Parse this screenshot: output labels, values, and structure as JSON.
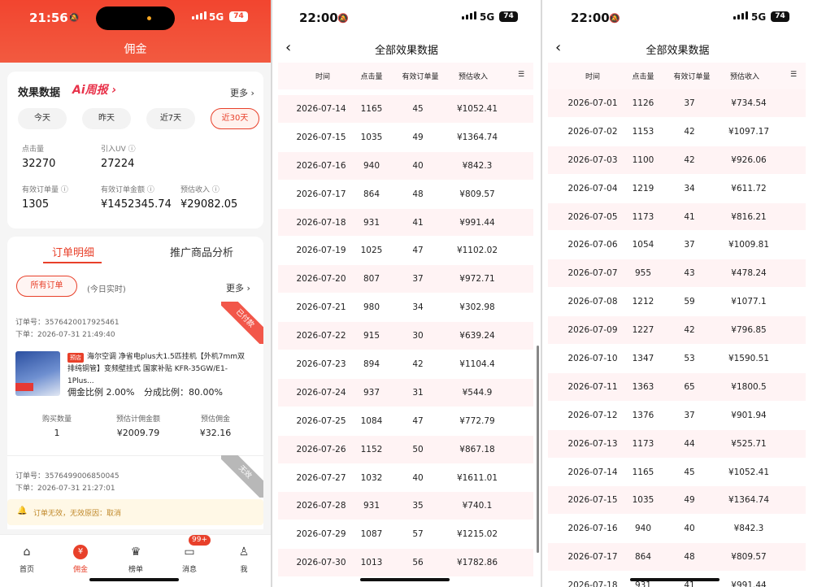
{
  "phone1": {
    "status": {
      "time": "21:56",
      "network": "5G",
      "battery": "74"
    },
    "title": "佣金",
    "effect": {
      "heading": "效果数据",
      "ai_badge": "Ai周报 ›",
      "more": "更多 ›",
      "tabs": [
        "今天",
        "昨天",
        "近7天",
        "近30天"
      ],
      "active_tab": "近30天",
      "stats": [
        {
          "label": "点击量",
          "value": "32270"
        },
        {
          "label": "引入UV ⓘ",
          "value": "27224"
        },
        {
          "label": "有效订单量 ⓘ",
          "value": "1305"
        },
        {
          "label": "有效订单金额 ⓘ",
          "value": "¥1452345.74"
        },
        {
          "label": "预估收入 ⓘ",
          "value": "¥29082.05"
        }
      ]
    },
    "segments": [
      "订单明细",
      "推广商品分析"
    ],
    "filter": {
      "pill": "所有订单",
      "realtime": "(今日实时)",
      "more": "更多 ›"
    },
    "order1": {
      "id": "订单号：3576420017925461",
      "time": "下单：2026-07-31 21:49:40",
      "ribbon": "已付款",
      "tag": "预店",
      "desc": "海尔空调 净省电plus大1.5匹挂机【外机7mm双排纯铜管】变频壁挂式 国家补贴 KFR-35GW/E1-1Plus...",
      "commission_rate": "佣金比例 2.00%",
      "share_rate": "分成比例：80.00%",
      "cols": [
        "购买数量",
        "预估计佣金额",
        "预估佣金"
      ],
      "vals": [
        "1",
        "¥2009.79",
        "¥32.16"
      ]
    },
    "order2": {
      "id": "订单号：3576499006850045",
      "time": "下单：2026-07-31 21:27:01",
      "ribbon": "无效"
    },
    "warning": "订单无效，无效原因：取消",
    "nav": [
      {
        "label": "首页",
        "icon": "home-icon"
      },
      {
        "label": "佣金",
        "icon": "yen-icon"
      },
      {
        "label": "榜单",
        "icon": "trophy-icon"
      },
      {
        "label": "消息",
        "icon": "message-icon"
      },
      {
        "label": "我",
        "icon": "user-icon"
      }
    ],
    "badge": "99+",
    "accent": "#e8402a"
  },
  "phone2": {
    "status": {
      "time": "22:00",
      "network": "5G",
      "battery": "74"
    },
    "title": "全部效果数据",
    "columns": [
      "时间",
      "点击量",
      "有效订单量",
      "预估收入"
    ],
    "rows": [
      [
        "2026-07-14",
        "1165",
        "45",
        "¥1052.41"
      ],
      [
        "2026-07-15",
        "1035",
        "49",
        "¥1364.74"
      ],
      [
        "2026-07-16",
        "940",
        "40",
        "¥842.3"
      ],
      [
        "2026-07-17",
        "864",
        "48",
        "¥809.57"
      ],
      [
        "2026-07-18",
        "931",
        "41",
        "¥991.44"
      ],
      [
        "2026-07-19",
        "1025",
        "47",
        "¥1102.02"
      ],
      [
        "2026-07-20",
        "807",
        "37",
        "¥972.71"
      ],
      [
        "2026-07-21",
        "980",
        "34",
        "¥302.98"
      ],
      [
        "2026-07-22",
        "915",
        "30",
        "¥639.24"
      ],
      [
        "2026-07-23",
        "894",
        "42",
        "¥1104.4"
      ],
      [
        "2026-07-24",
        "937",
        "31",
        "¥544.9"
      ],
      [
        "2026-07-25",
        "1084",
        "47",
        "¥772.79"
      ],
      [
        "2026-07-26",
        "1152",
        "50",
        "¥867.18"
      ],
      [
        "2026-07-27",
        "1032",
        "40",
        "¥1611.01"
      ],
      [
        "2026-07-28",
        "931",
        "35",
        "¥740.1"
      ],
      [
        "2026-07-29",
        "1087",
        "57",
        "¥1215.02"
      ],
      [
        "2026-07-30",
        "1013",
        "56",
        "¥1782.86"
      ]
    ]
  },
  "phone3": {
    "status": {
      "time": "22:00",
      "network": "5G",
      "battery": "74"
    },
    "title": "全部效果数据",
    "columns": [
      "时间",
      "点击量",
      "有效订单量",
      "预估收入"
    ],
    "rows": [
      [
        "2026-07-01",
        "1126",
        "37",
        "¥734.54"
      ],
      [
        "2026-07-02",
        "1153",
        "42",
        "¥1097.17"
      ],
      [
        "2026-07-03",
        "1100",
        "42",
        "¥926.06"
      ],
      [
        "2026-07-04",
        "1219",
        "34",
        "¥611.72"
      ],
      [
        "2026-07-05",
        "1173",
        "41",
        "¥816.21"
      ],
      [
        "2026-07-06",
        "1054",
        "37",
        "¥1009.81"
      ],
      [
        "2026-07-07",
        "955",
        "43",
        "¥478.24"
      ],
      [
        "2026-07-08",
        "1212",
        "59",
        "¥1077.1"
      ],
      [
        "2026-07-09",
        "1227",
        "42",
        "¥796.85"
      ],
      [
        "2026-07-10",
        "1347",
        "53",
        "¥1590.51"
      ],
      [
        "2026-07-11",
        "1363",
        "65",
        "¥1800.5"
      ],
      [
        "2026-07-12",
        "1376",
        "37",
        "¥901.94"
      ],
      [
        "2026-07-13",
        "1173",
        "44",
        "¥525.71"
      ],
      [
        "2026-07-14",
        "1165",
        "45",
        "¥1052.41"
      ],
      [
        "2026-07-15",
        "1035",
        "49",
        "¥1364.74"
      ],
      [
        "2026-07-16",
        "940",
        "40",
        "¥842.3"
      ],
      [
        "2026-07-17",
        "864",
        "48",
        "¥809.57"
      ],
      [
        "2026-07-18",
        "931",
        "41",
        "¥991.44"
      ]
    ]
  }
}
